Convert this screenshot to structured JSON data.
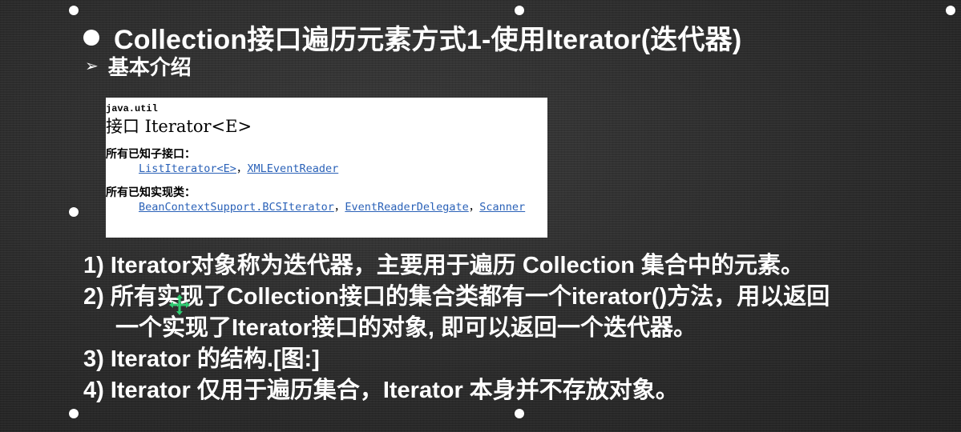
{
  "slide": {
    "title": "Collection接口遍历元素方式1-使用Iterator(迭代器)",
    "subtitle": "基本介绍",
    "subtitle_marker": "➢"
  },
  "doc": {
    "package": "java.util",
    "heading": "接口 Iterator<E>",
    "known_subinterfaces_label": "所有已知子接口：",
    "known_subinterfaces": [
      "ListIterator<E>",
      "XMLEventReader"
    ],
    "known_impl_label": "所有已知实现类：",
    "known_impl": [
      "BeanContextSupport.BCSIterator",
      "EventReaderDelegate",
      "Scanner"
    ],
    "separator": "，",
    "link_color": "#2b62b8"
  },
  "points": [
    "1) Iterator对象称为迭代器，主要用于遍历 Collection 集合中的元素。",
    "2) 所有实现了Collection接口的集合类都有一个iterator()方法，用以返回",
    "一个实现了Iterator接口的对象, 即可以返回一个迭代器。",
    "3) Iterator 的结构.[图:]",
    "4) Iterator 仅用于遍历集合，Iterator 本身并不存放对象。"
  ],
  "colors": {
    "background": "#2f2f2f",
    "text": "#ffffff",
    "cursor": "#2ecc71"
  },
  "icons": {
    "bullet": "filled-circle",
    "subtitle_marker": "arrowhead",
    "cursor": "move-cursor"
  }
}
